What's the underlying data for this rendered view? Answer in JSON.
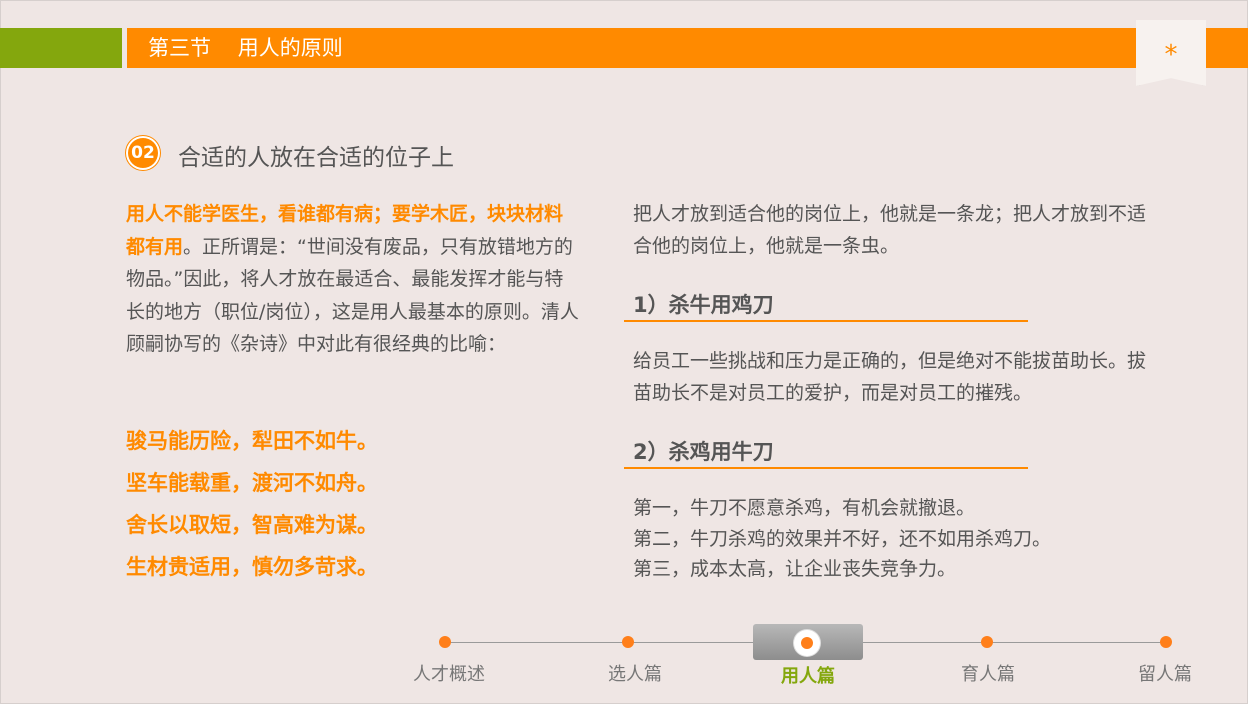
{
  "header": {
    "section_title": "第三节    用人的原则",
    "bookmark_icon": "asterisk-icon",
    "colors": {
      "accent": "#ff8a00",
      "green": "#84a70d",
      "background": "#efe6e4"
    }
  },
  "heading": {
    "badge": "02",
    "title": "合适的人放在合适的位子上"
  },
  "left": {
    "highlight": "用人不能学医生，看谁都有病；要学木匠，块块材料都有用",
    "body": "。正所谓是：“世间没有废品，只有放错地方的物品。”因此，将人才放在最适合、最能发挥才能与特长的地方（职位/岗位），这是用人最基本的原则。清人顾嗣协写的《杂诗》中对此有很经典的比喻：",
    "poem": [
      "骏马能历险，犁田不如牛。",
      "坚车能载重，渡河不如舟。",
      "舍长以取短，智高难为谋。",
      "生材贵适用，慎勿多苛求。"
    ]
  },
  "right": {
    "intro": "把人才放到适合他的岗位上，他就是一条龙；把人才放到不适合他的岗位上，他就是一条虫。",
    "section1": {
      "title": "1）杀牛用鸡刀",
      "body": "给员工一些挑战和压力是正确的，但是绝对不能拔苗助长。拔苗助长不是对员工的爱护，而是对员工的摧残。"
    },
    "section2": {
      "title": "2）杀鸡用牛刀",
      "lines": [
        "第一，牛刀不愿意杀鸡，有机会就撤退。",
        "第二，牛刀杀鸡的效果并不好，还不如用杀鸡刀。",
        "第三，成本太高，让企业丧失竞争力。"
      ]
    }
  },
  "timeline": {
    "items": [
      {
        "label": "人才概述"
      },
      {
        "label": "选人篇"
      },
      {
        "label": "用人篇",
        "active": true
      },
      {
        "label": "育人篇"
      },
      {
        "label": "留人篇"
      }
    ]
  }
}
